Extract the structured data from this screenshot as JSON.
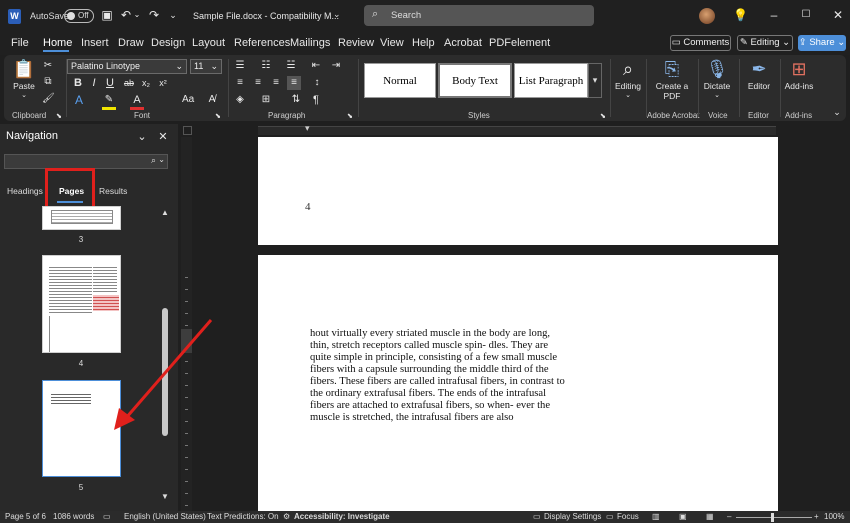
{
  "titlebar": {
    "app_icon": "W",
    "autosave_label": "AutoSave",
    "autosave_state": "Off",
    "doc_title": "Sample File.docx  -  Compatibility M...",
    "search_placeholder": "Search"
  },
  "menu": {
    "items": [
      "File",
      "Home",
      "Insert",
      "Draw",
      "Design",
      "Layout",
      "References",
      "Mailings",
      "Review",
      "View",
      "Help",
      "Acrobat",
      "PDFelement"
    ],
    "active": "Home",
    "comments": "Comments",
    "editing": "Editing",
    "share": "Share"
  },
  "ribbon": {
    "clipboard": {
      "paste": "Paste",
      "label": "Clipboard"
    },
    "font": {
      "name": "Palatino Linotype",
      "size": "11",
      "label": "Font"
    },
    "paragraph": {
      "label": "Paragraph"
    },
    "styles": {
      "items": [
        "Normal",
        "Body Text",
        "List Paragraph"
      ],
      "label": "Styles"
    },
    "editing": {
      "label": "Editing"
    },
    "acrobat": {
      "create_pdf": "Create a PDF",
      "label": "Adobe Acrobat"
    },
    "voice": {
      "dictate": "Dictate",
      "label": "Voice"
    },
    "editor": {
      "editor": "Editor",
      "label": "Editor"
    },
    "addins": {
      "addins": "Add-ins",
      "label": "Add-ins"
    }
  },
  "nav": {
    "title": "Navigation",
    "tabs": [
      "Headings",
      "Pages",
      "Results"
    ],
    "active_tab": "Pages",
    "thumb_numbers": [
      "3",
      "4",
      "5"
    ],
    "selected_page": "5"
  },
  "document": {
    "page_number": "4",
    "lines": [
      "hout virtually every striated muscle in the body are long,",
      "thin, stretch receptors called muscle spin- dles. They are",
      "quite simple in principle, consisting of a few small muscle",
      "fibers with a capsule surrounding the middle third of the",
      "fibers. These fibers are called intrafusal fibers, in contrast to",
      "the ordinary extrafusal fibers. The ends of the intrafusal",
      "fibers are attached to extrafusal fibers, so when- ever the",
      "muscle is stretched, the intrafusal fibers are also"
    ]
  },
  "status": {
    "page": "Page 5 of 6",
    "words": "1086 words",
    "language": "English (United States)",
    "predictions": "Text Predictions: On",
    "accessibility": "Accessibility: Investigate",
    "display": "Display Settings",
    "focus": "Focus",
    "zoom": "100%"
  },
  "colors": {
    "accent": "#4d8fd9",
    "highlight_box": "#e0201c",
    "arrow": "#e0201c"
  }
}
